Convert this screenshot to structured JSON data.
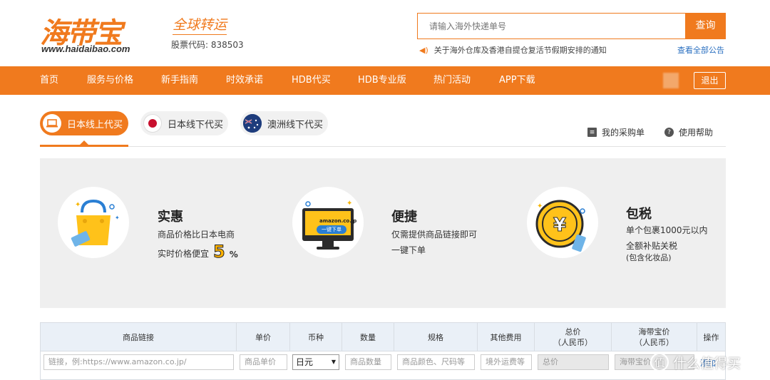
{
  "header": {
    "logo_text": "海带宝",
    "logo_url": "www.haidaibao.com",
    "slogan": "全球转运",
    "stock_code": "股票代码: 838503",
    "search_placeholder": "请输入海外快递单号",
    "search_button": "查询",
    "notice": "关于海外仓库及香港自提仓复活节假期安排的通知",
    "all_notices": "查看全部公告"
  },
  "nav": {
    "items": [
      "首页",
      "服务与价格",
      "新手指南",
      "时效承诺",
      "HDB代买",
      "HDB专业版",
      "热门活动",
      "APP下载"
    ],
    "logout": "退出"
  },
  "tabs": {
    "items": [
      "日本线上代买",
      "日本线下代买",
      "澳洲线下代买"
    ],
    "active_index": 0,
    "links": [
      "我的采购单",
      "使用帮助"
    ]
  },
  "features": [
    {
      "title": "实惠",
      "line1": "商品价格比日本电商",
      "line2": "实时价格便宜",
      "highlight": "5",
      "suffix": "%"
    },
    {
      "title": "便捷",
      "line1": "仅需提供商品链接即可",
      "line2": "一键下单",
      "badge_top": "amazon.co.jp",
      "badge": "一键下单"
    },
    {
      "title": "包税",
      "line1": "单个包裹1000元以内",
      "line2": "全额补贴关税",
      "line3": "(包含化妆品)"
    }
  ],
  "table": {
    "headers": [
      "商品链接",
      "单价",
      "币种",
      "数量",
      "规格",
      "其他费用",
      "总价\n（人民币）",
      "海带宝价\n（人民币）",
      "操作"
    ],
    "row": {
      "link_placeholder": "链接，例:https://www.amazon.co.jp/",
      "price_placeholder": "商品单价",
      "currency": "日元",
      "qty_placeholder": "商品数量",
      "spec_placeholder": "商品颜色、尺码等",
      "other_placeholder": "境外运费等",
      "total_placeholder": "总价",
      "hdb_placeholder": "海带宝价",
      "action": "添加"
    }
  },
  "watermark": "什么值得买",
  "colors": {
    "accent": "#f07a1e",
    "link": "#2a6fc0",
    "table_header": "#eaf0f7"
  }
}
